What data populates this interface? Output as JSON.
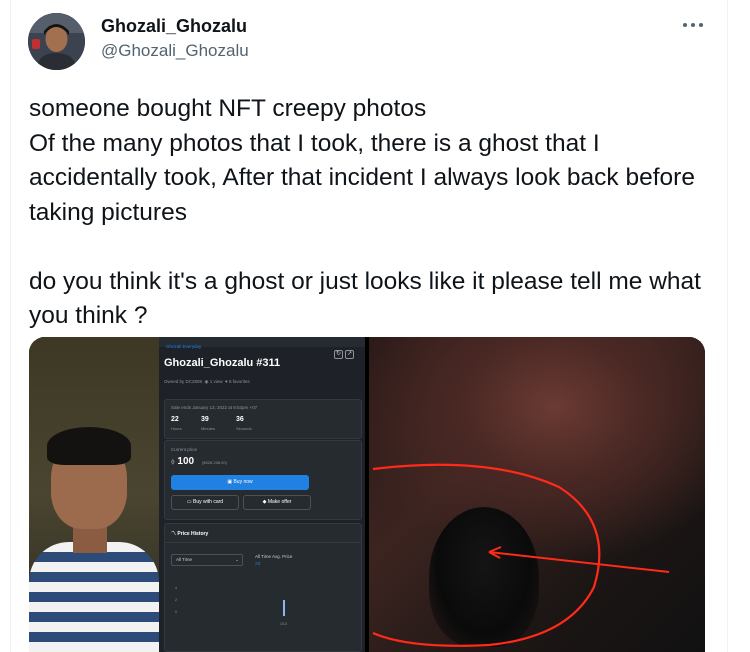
{
  "tweet": {
    "display_name": "Ghozali_Ghozalu",
    "handle": "@Ghozali_Ghozalu",
    "more_icon": "more-horizontal-icon",
    "text": "someone bought NFT creepy photos\nOf the many photos that I took, there is a ghost that I accidentally took, After that incident I always look back before taking pictures\n\ndo you think it's a ghost or just looks like it please tell me what you think ?"
  },
  "nft": {
    "collection": "Ghozali Everyday",
    "title": "Ghozali_Ghozalu #311",
    "owned_by": "Owned by DC2808",
    "views": "1 view",
    "favorites": "8 favorites",
    "sale_ends": "Sale ends January 13, 2022 at 9:53pm +07",
    "countdown": [
      {
        "value": "22",
        "unit": "Hours"
      },
      {
        "value": "39",
        "unit": "Minutes"
      },
      {
        "value": "36",
        "unit": "Seconds"
      }
    ],
    "current_price_label": "Current price",
    "price": "100",
    "price_usd": "($326,238.00)",
    "buy_now": "Buy now",
    "buy_with_card": "Buy with card",
    "make_offer": "Make offer",
    "price_history": "Price History",
    "time_filter": "All Time",
    "avg_price_label": "All Time Avg. Price",
    "avg_price_value": "Ξ0",
    "y_ticks": [
      "4",
      "2",
      "0"
    ],
    "x_tick": "1/13"
  },
  "colors": {
    "accent": "#2081e2",
    "red_annotation": "#ff2a1a"
  }
}
